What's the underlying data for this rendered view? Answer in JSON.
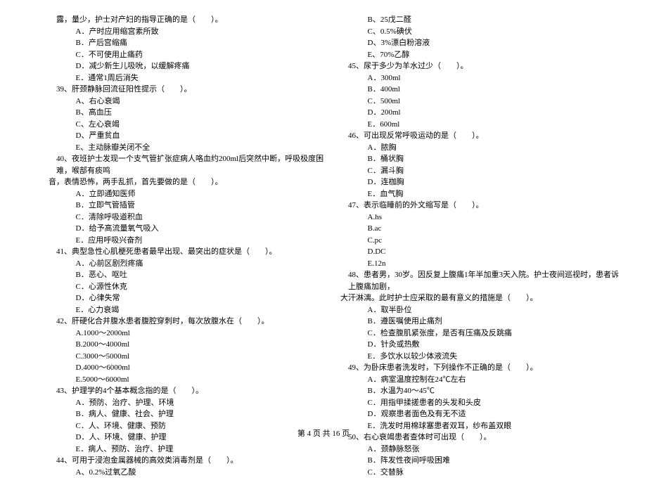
{
  "footer": "第 4 页 共 16 页",
  "left": {
    "frag1": "露，量少，护士对产妇的指导正确的是（　　）。",
    "frag1_opts": [
      "A．产时应用缩宫素所致",
      "B．产后宫缩痛",
      "C．不可使用止痛药",
      "D．减少新生儿吸吮，以缓解疼痛",
      "E．通常1周后消失"
    ],
    "q39": "39、肝颈静脉回流征阳性提示（　　）。",
    "q39_opts": [
      "A、右心衰竭",
      "B、高血压",
      "C、左心衰竭",
      "D、严重贫血",
      "E、主动脉瓣关闭不全"
    ],
    "q40a": "40、夜班护士发现一个支气管扩张症病人咯血约200ml后突然中断，呼吸极度困难，喉部有痰鸣",
    "q40b": "音，表情恐怖，两手乱抓，首先要做的是（　　）。",
    "q40_opts": [
      "A．立即通知医师",
      "B．立即气管插管",
      "C．清除呼吸道积血",
      "D．给予高流量氧气吸入",
      "E．应用呼吸兴奋剂"
    ],
    "q41": "41、典型急性心肌梗死患者最早出现、最突出的症状是（　　）。",
    "q41_opts": [
      "A．心前区剧烈疼痛",
      "B．恶心、呕吐",
      "C．心源性休克",
      "D．心律失常",
      "E．心力衰竭"
    ],
    "q42": "42、肝硬化合并腹水患者腹腔穿刺时，每次放腹水在（　　）。",
    "q42_opts": [
      "A.1000～2000ml",
      "B.2000～4000ml",
      "C.3000～5000ml",
      "D.4000～6000ml",
      "E.5000～6000ml"
    ],
    "q43": "43、护理学的4个基本概念指的是（　　）。",
    "q43_opts": [
      "A．预防、治疗、护理、环境",
      "B．病人、健康、社会、护理",
      "C．人、环境、健康、预防",
      "D．人、环境、健康、护理",
      "E．病人、预防、治疗、护理"
    ],
    "q44": "44、可用于浸泡金属器械的高效类消毒剂是（　　）。",
    "q44_opts": [
      "A、0.2%过氧乙酸"
    ]
  },
  "right": {
    "q44_opts": [
      "B、25戊二醛",
      "C、0.5%碘伏",
      "D、3%漂白粉溶液",
      "E、70%乙醇"
    ],
    "q45": "45、尿于多少为羊水过少（　　）。",
    "q45_opts": [
      "A．300ml",
      "B．400ml",
      "C．500ml",
      "D．200ml",
      "E．600ml"
    ],
    "q46": "46、可出现反常呼吸运动的是（　　）。",
    "q46_opts": [
      "A．脓胸",
      "B．桶状胸",
      "C．漏斗胸",
      "D．连枷胸",
      "E．血气胸"
    ],
    "q47": "47、表示临睡前的外文缩写是（　　）。",
    "q47_opts": [
      "A.hs",
      "B.ac",
      "C.pc",
      "D.DC",
      "E.12n"
    ],
    "q48a": "48、患者男，30岁。因反复上腹痛1年半加重3天入院。护士夜间巡视时，患者诉上腹痛加剧，",
    "q48b": "大汗淋漓。此时护士应采取的最有意义的措施是（　　）。",
    "q48_opts": [
      "A．取半卧位",
      "B．遵医嘱使用止痛剂",
      "C．检查腹肌紧张度，是否有压痛及反跳痛",
      "D．针灸或热敷",
      "E．多饮水以较少体液流失"
    ],
    "q49": "49、为卧床患者洗发时，下列操作不正确的是（　　）。",
    "q49_opts": [
      "A．病室温度控制在24℃左右",
      "B．水温为40～45℃",
      "C．用指甲揉搓患者的头发和头皮",
      "D．观察患者面色及有无不适",
      "E．洗发时用棉球塞患者双耳，纱布盖双眼"
    ],
    "q50": "50、右心衰竭患者查体时可出现（　　）。",
    "q50_opts": [
      "A．颈静脉怒张",
      "B．阵发性夜间呼吸困难",
      "C．交替脉"
    ]
  }
}
